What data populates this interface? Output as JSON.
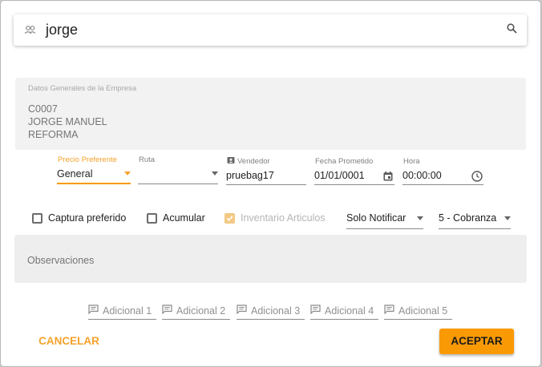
{
  "search": {
    "value": "jorge"
  },
  "company": {
    "title": "Datos Generales de la Empresa",
    "code": "C0007",
    "name": "JORGE MANUEL",
    "address": "REFORMA"
  },
  "fields": {
    "precio": {
      "label": "Precio Preferente",
      "value": "General"
    },
    "ruta": {
      "label": "Ruta",
      "value": ""
    },
    "vendedor": {
      "label": "Vendedor",
      "value": "pruebag17"
    },
    "fecha": {
      "label": "Fecha Prometido",
      "value": "01/01/0001"
    },
    "hora": {
      "label": "Hora",
      "value": "00:00:00"
    }
  },
  "checkboxes": {
    "captura": {
      "label": "Captura preferido",
      "checked": false
    },
    "acumular": {
      "label": "Acumular",
      "checked": false
    },
    "inventario": {
      "label": "Inventario Articulos",
      "checked": true,
      "disabled": true
    }
  },
  "selects": {
    "notificar": "Solo Notificar",
    "cobranza": "5 - Cobranza"
  },
  "observaciones": {
    "placeholder": "Observaciones"
  },
  "adicionales": [
    "Adicional 1",
    "Adicional 2",
    "Adicional 3",
    "Adicional 4",
    "Adicional 5"
  ],
  "buttons": {
    "cancel": "CANCELAR",
    "accept": "ACEPTAR"
  },
  "colors": {
    "accent": "#f99a05",
    "accent_text": "#f5a32c"
  }
}
